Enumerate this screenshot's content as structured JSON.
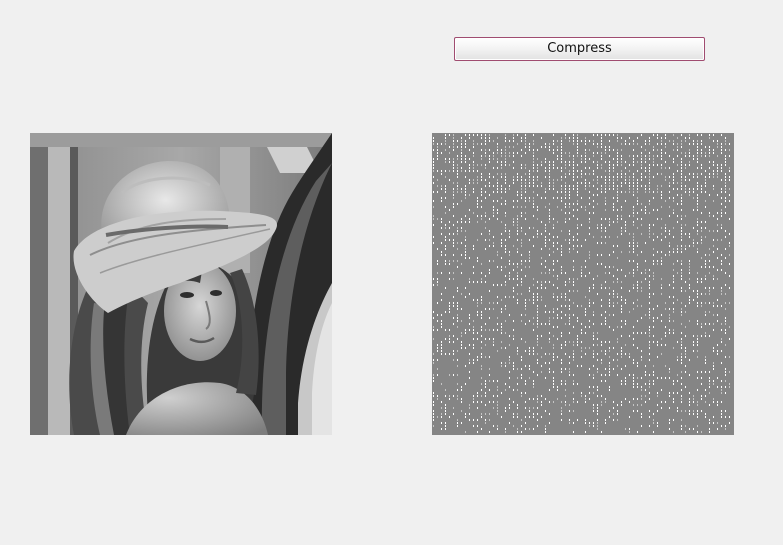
{
  "toolbar": {
    "compress_label": "Compress"
  },
  "images": {
    "original": {
      "icon": "grayscale-photo-portrait",
      "tone": "#6e6e6e"
    },
    "compressed": {
      "icon": "compressed-noise-image",
      "tone": "#858585"
    }
  },
  "colors": {
    "window_background": "#f0f0f0",
    "button_border": "#a04c70"
  }
}
